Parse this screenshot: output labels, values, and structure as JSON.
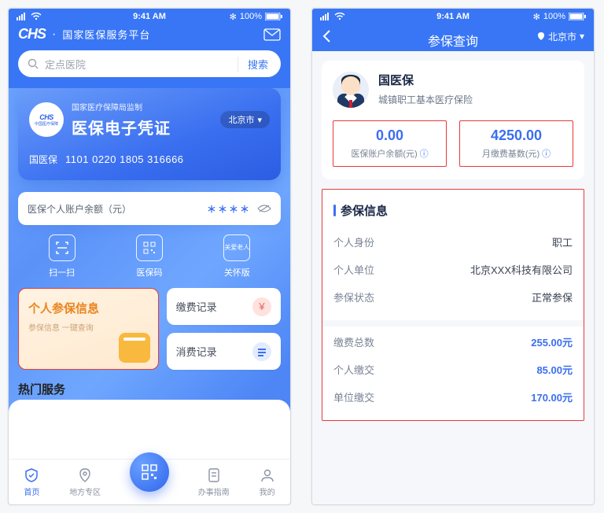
{
  "status": {
    "time": "9:41 AM",
    "battery": "100%"
  },
  "p1": {
    "header": {
      "logo": "CHS",
      "title": "国家医保服务平台"
    },
    "search": {
      "placeholder": "定点医院",
      "button": "搜索"
    },
    "card": {
      "supervisor": "国家医疗保障局监制",
      "title": "医保电子凭证",
      "city": "北京市",
      "name": "国医保",
      "number": "1101 0220 1805 316666"
    },
    "balance_label": "医保个人账户余额（元）",
    "quick": [
      {
        "label": "扫一扫"
      },
      {
        "label": "医保码"
      },
      {
        "label": "关怀版",
        "sup": "关爱老人"
      }
    ],
    "info_card": {
      "title": "个人参保信息",
      "subtitle": "参保信息 一键查询"
    },
    "small_cards": [
      {
        "label": "缴费记录"
      },
      {
        "label": "消费记录"
      }
    ],
    "hot_title": "热门服务",
    "tabs": [
      {
        "label": "首页"
      },
      {
        "label": "地方专区"
      },
      {
        "label": ""
      },
      {
        "label": "办事指南"
      },
      {
        "label": "我的"
      }
    ]
  },
  "p2": {
    "title": "参保查询",
    "city": "北京市",
    "profile": {
      "name": "国医保",
      "type": "城镇职工基本医疗保险"
    },
    "stats": [
      {
        "value": "0.00",
        "label": "医保账户余额(元)"
      },
      {
        "value": "4250.00",
        "label": "月缴费基数(元)"
      }
    ],
    "info_title": "参保信息",
    "rows1": [
      {
        "k": "个人身份",
        "v": "职工"
      },
      {
        "k": "个人单位",
        "v": "北京XXX科技有限公司"
      },
      {
        "k": "参保状态",
        "v": "正常参保"
      }
    ],
    "rows2": [
      {
        "k": "缴费总数",
        "v": "255.00元"
      },
      {
        "k": "个人缴交",
        "v": "85.00元"
      },
      {
        "k": "单位缴交",
        "v": "170.00元"
      }
    ]
  }
}
